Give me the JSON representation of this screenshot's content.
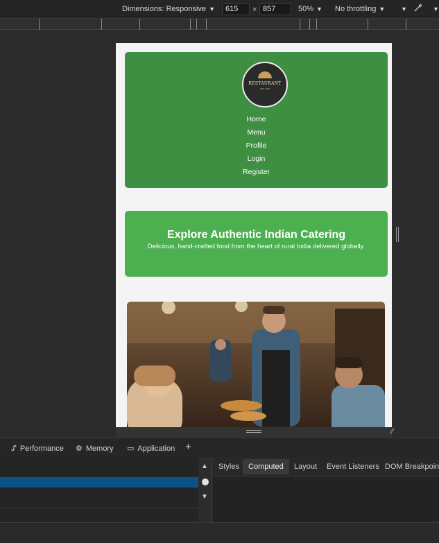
{
  "device_toolbar": {
    "dimensions_label": "Dimensions: Responsive",
    "width_value": "615",
    "times": "×",
    "height_value": "857",
    "zoom": "50%",
    "throttling": "No throttling"
  },
  "site": {
    "logo_text": "RESTAURANT",
    "logo_sub": "EST. 2020",
    "nav": [
      "Home",
      "Menu",
      "Profile",
      "Login",
      "Register"
    ],
    "hero_title": "Explore Authentic Indian Catering",
    "hero_subtitle": "Delicious, hand-crafted food from the heart of rural India delivered globally.",
    "colors": {
      "header": "#3e8f41",
      "hero": "#4caf50"
    }
  },
  "drawer": {
    "tabs": [
      {
        "label": "Performance",
        "icon": "performance-icon"
      },
      {
        "label": "Memory",
        "icon": "memory-icon"
      },
      {
        "label": "Application",
        "icon": "application-icon"
      }
    ],
    "add_tab": "+"
  },
  "sidebar_tabs": [
    "Styles",
    "Computed",
    "Layout",
    "Event Listeners",
    "DOM Breakpoints"
  ],
  "active_sidebar_tab": "Computed"
}
